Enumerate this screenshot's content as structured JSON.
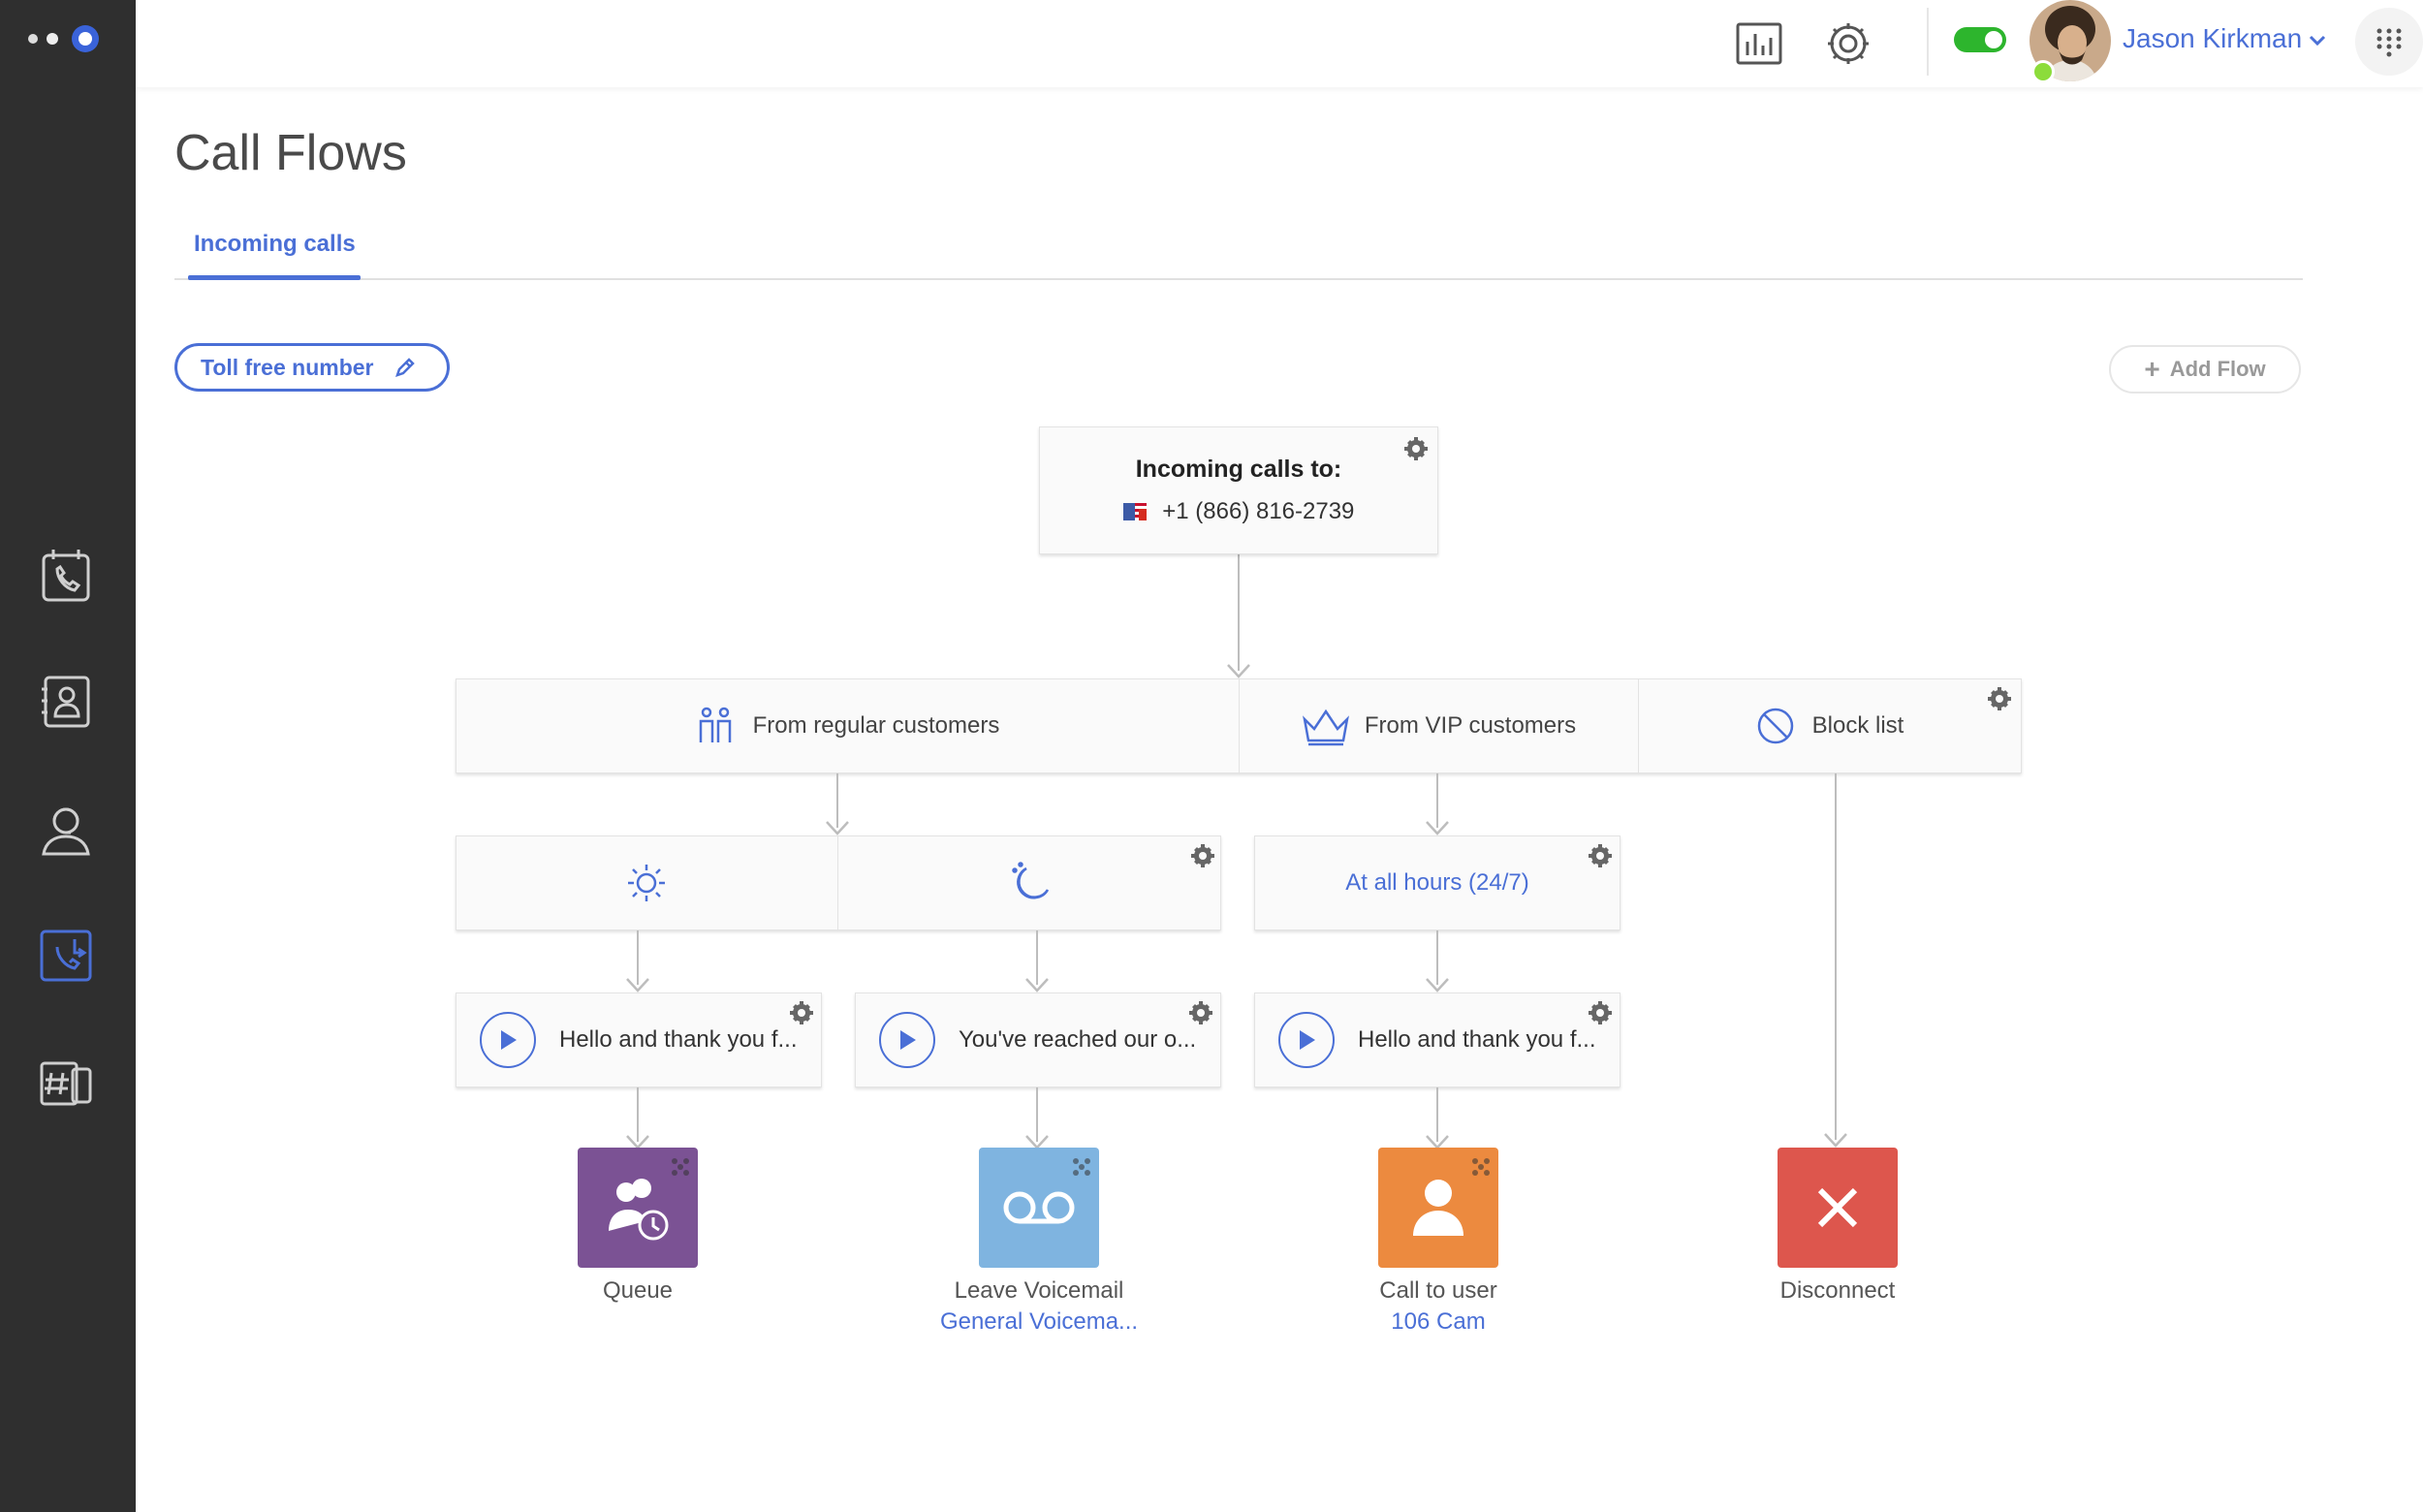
{
  "header": {
    "user_name": "Jason Kirkman",
    "status_toggle_on": true
  },
  "page": {
    "title": "Call Flows",
    "tabs": [
      {
        "label": "Incoming calls",
        "active": true
      }
    ],
    "number_button_label": "Toll free number",
    "add_flow_label": "Add Flow"
  },
  "flow": {
    "root": {
      "title": "Incoming calls to:",
      "number": "+1 (866) 816-2739"
    },
    "segments": [
      {
        "label": "From regular customers",
        "icon": "people-icon"
      },
      {
        "label": "From VIP customers",
        "icon": "crown-icon"
      },
      {
        "label": "Block list",
        "icon": "block-icon"
      }
    ],
    "schedules": [
      {
        "label": "",
        "icon": "sun-icon"
      },
      {
        "label": "",
        "icon": "moon-icon"
      },
      {
        "label": "At all hours (24/7)"
      }
    ],
    "messages": [
      {
        "text": "Hello and thank you f..."
      },
      {
        "text": "You've reached our o..."
      },
      {
        "text": "Hello and thank you f..."
      }
    ],
    "endpoints": [
      {
        "label": "Queue",
        "sub": "",
        "color": "#7b5294",
        "icon": "queue-icon"
      },
      {
        "label": "Leave Voicemail",
        "sub": "General Voicema...",
        "color": "#7fb4e0",
        "icon": "voicemail-icon"
      },
      {
        "label": "Call to user",
        "sub": "106 Cam",
        "color": "#ec8a3f",
        "icon": "user-icon"
      },
      {
        "label": "Disconnect",
        "sub": "",
        "color": "#dd564d",
        "icon": "close-icon"
      }
    ]
  },
  "colors": {
    "accent": "#4a6fd6",
    "sidebar": "#2f2f2f",
    "toggle": "#2db52d"
  }
}
